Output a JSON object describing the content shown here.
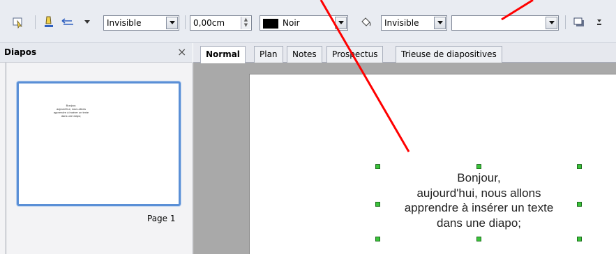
{
  "toolbar": {
    "line_style_value": "Invisible",
    "line_width_value": "0,00cm",
    "line_color_value": "Noir",
    "area_style_value": "Invisible",
    "area_fill_value": "",
    "colors": {
      "line_color_swatch": "#000000",
      "toolbar_bg": "#e9ecf2"
    }
  },
  "slides_pane": {
    "title": "Diapos",
    "close_glyph": "×",
    "thumbnail_text": "Bonjour,\naujourd'hui, nous allons\napprendre à insérer un texte\ndans une diapo;",
    "page_label": "Page 1"
  },
  "view_tabs": [
    "Normal",
    "Plan",
    "Notes",
    "Prospectus",
    "Trieuse de diapositives"
  ],
  "active_tab": "Normal",
  "slide": {
    "text_lines": [
      "Bonjour,",
      "aujourd'hui, nous allons",
      "apprendre à insérer un texte",
      "dans une diapo;"
    ]
  },
  "annotations": {
    "arrow_color": "#ff0000"
  }
}
